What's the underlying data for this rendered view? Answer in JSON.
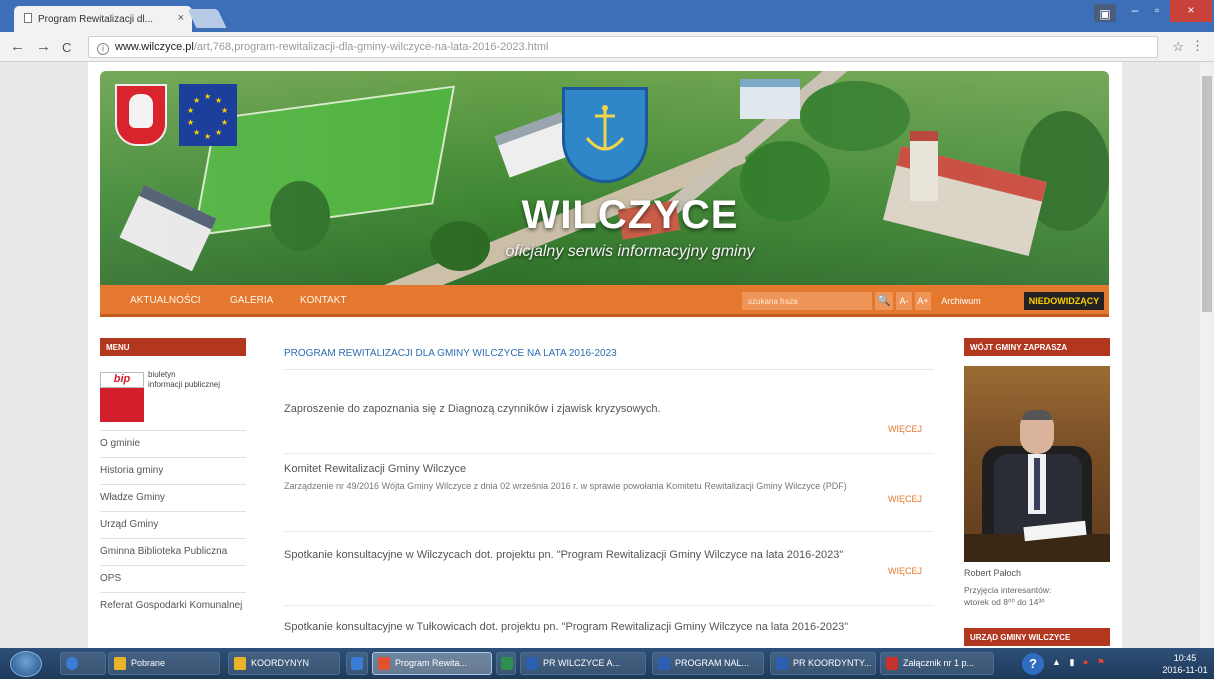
{
  "browser": {
    "tab_title": "Program Rewitalizacji dl...",
    "tab_close": "×",
    "url_host": "www.wilczyce.pl",
    "url_path": "/art,768,program-rewitalizacji-dla-gminy-wilczyce-na-lata-2016-2023.html",
    "back": "←",
    "forward": "→",
    "reload": "C",
    "bookmark": "☆",
    "menu": "⋮",
    "window_min": "–",
    "window_max": "▫",
    "window_close": "×"
  },
  "header": {
    "site_title": "WILCZYCE",
    "site_subtitle": "oficjalny serwis informacyjny gminy"
  },
  "nav": {
    "items": [
      "AKTUALNOŚCI",
      "GALERIA",
      "KONTAKT"
    ],
    "search_placeholder": "szukana fraza",
    "search_icon": "🔍",
    "font_minus": "A-",
    "font_plus": "A+",
    "archive": "Archiwum",
    "accessibility": "NIEDOWIDZĄCY"
  },
  "sidebar": {
    "menu_heading": "MENU",
    "bip_tag": "bip",
    "bip_text_1": "biuletyn",
    "bip_text_2": "informacji publicznej",
    "items": [
      "O gminie",
      "Historia gminy",
      "Władze Gminy",
      "Urząd Gminy",
      "Gminna Biblioteka Publiczna",
      "OPS",
      "Referat Gospodarki Komunalnej"
    ]
  },
  "main": {
    "title": "PROGRAM REWITALIZACJI DLA GMINY WILCZYCE NA LATA 2016-2023",
    "more_label": "WIĘCEJ",
    "articles": [
      {
        "title": "Zaproszenie do zapoznania się z Diagnozą czynników i zjawisk kryzysowych.",
        "desc": ""
      },
      {
        "title": "Komitet Rewitalizacji Gminy Wilczyce",
        "desc": "Zarządzenie nr 49/2016 Wójta Gminy Wilczyce z dnia 02 września 2016 r. w sprawie powołania Komitetu Rewitalizacji Gminy Wilczyce (PDF)"
      },
      {
        "title": "Spotkanie konsultacyjne w Wilczycach dot. projektu pn. \"Program Rewitalizacji Gminy Wilczyce na lata 2016-2023\"",
        "desc": ""
      },
      {
        "title": "Spotkanie konsultacyjne w Tułkowicach dot. projektu pn. \"Program Rewitalizacji Gminy Wilczyce na lata 2016-2023\"",
        "desc": ""
      }
    ]
  },
  "right": {
    "mayor_heading": "WÓJT GMINY ZAPRASZA",
    "mayor_name": "Robert Pałoch",
    "hours_line1": "Przyjęcia interesantów:",
    "hours_line2": "wtorek od 8⁰⁰ do 14³⁰",
    "office_heading": "URZĄD GMINY WILCZYCE"
  },
  "taskbar": {
    "items": [
      {
        "label": "Pobrane",
        "icon_color": "#e8b52a"
      },
      {
        "label": "KOORDYNYN",
        "icon_color": "#e8b52a"
      },
      {
        "label": "",
        "icon_color": "#3a7bd5"
      },
      {
        "label": "Program Rewita...",
        "icon_color": "#e0512f"
      },
      {
        "label": "",
        "icon_color": "#2f8f4e"
      },
      {
        "label": "PR WILCZYCE A...",
        "icon_color": "#2b5fb4"
      },
      {
        "label": "PROGRAM NAL...",
        "icon_color": "#2b5fb4"
      },
      {
        "label": "PR KOORDYNTY...",
        "icon_color": "#2b5fb4"
      },
      {
        "label": "Załącznik nr 1 p...",
        "icon_color": "#c8322d"
      }
    ],
    "help": "?",
    "time": "10:45",
    "date": "2016-11-01"
  }
}
